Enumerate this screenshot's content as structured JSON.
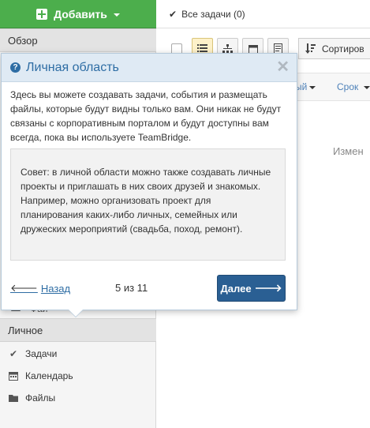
{
  "sidebar": {
    "add_button_label": "Добавить",
    "overview_label": "Обзор",
    "faded_item_label": "Фай",
    "personal_label": "Личное",
    "personal_items": [
      {
        "label": "Задачи",
        "icon": "check-icon"
      },
      {
        "label": "Календарь",
        "icon": "calendar-icon"
      },
      {
        "label": "Файлы",
        "icon": "folder-icon"
      }
    ]
  },
  "topbar": {
    "all_tasks_label": "Все задачи (0)"
  },
  "toolbar": {
    "sort_label": "Сортиров"
  },
  "subbar": {
    "link1": "ый",
    "link2": "Срок"
  },
  "main": {
    "change_text": "Измен"
  },
  "popover": {
    "title": "Личная область",
    "body": "Здесь вы можете создавать задачи, события и размещать файлы, которые будут видны только вам. Они никак не будут связаны с корпоративным порталом и будут доступны вам всегда, пока вы используете TeamBridge.",
    "tip": "Совет: в личной области можно также создавать личные проекты и приглашать в них своих друзей и знакомых. Например, можно организовать проект для планирования каких-либо личных, семейных или дружеских мероприятий (свадьба, поход, ремонт).",
    "back_label": "Назад",
    "counter": "5 из 11",
    "next_label": "Далее"
  },
  "colors": {
    "add_button": "#4cae4c",
    "popover_header": "#dfeaf4",
    "next_button": "#2a5f93",
    "link": "#2e6da4"
  }
}
